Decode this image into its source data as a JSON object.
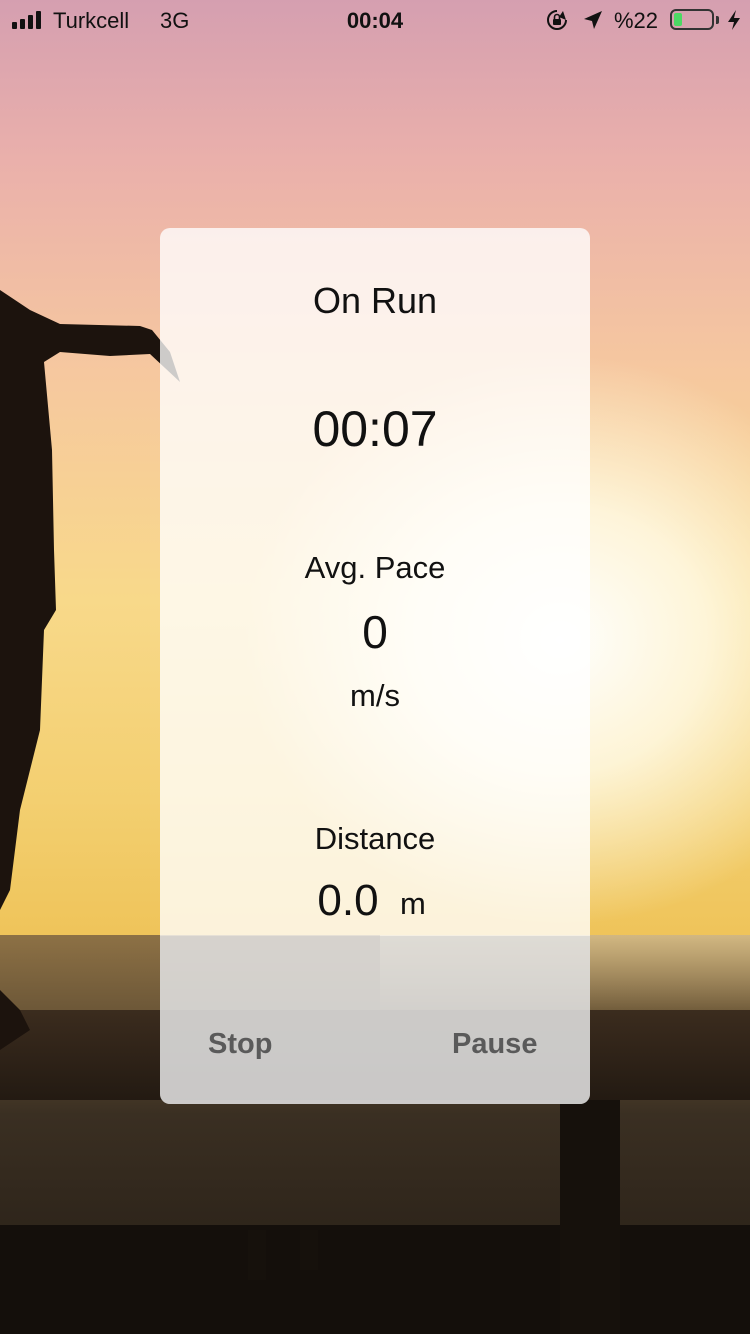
{
  "status_bar": {
    "carrier": "Turkcell",
    "network": "3G",
    "time": "00:04",
    "battery_percent": "%22",
    "battery_level": 0.22,
    "signal_bars": 4,
    "icons": [
      "signal-icon",
      "orientation-lock-icon",
      "location-arrow-icon",
      "battery-icon",
      "charging-bolt-icon"
    ]
  },
  "run": {
    "title": "On Run",
    "elapsed": "00:07",
    "pace_label": "Avg. Pace",
    "pace_value": "0",
    "pace_unit": "m/s",
    "distance_label": "Distance",
    "distance_value": "0.0",
    "distance_unit": "m"
  },
  "actions": {
    "stop_label": "Stop",
    "pause_label": "Pause"
  },
  "colors": {
    "card_text": "#111111",
    "button_text": "#5a5a5a",
    "battery_fill": "#4cd964"
  }
}
